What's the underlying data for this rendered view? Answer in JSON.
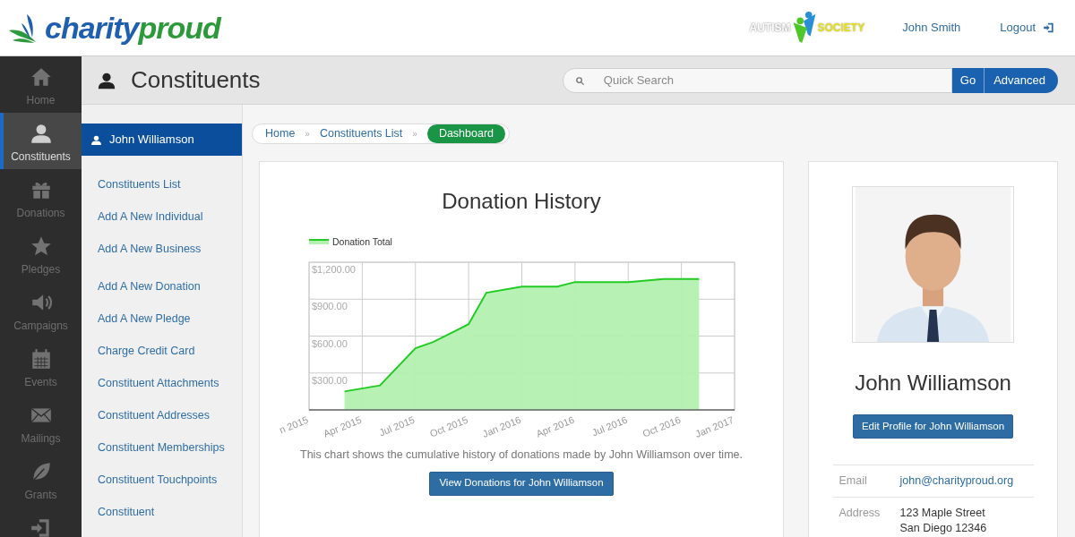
{
  "header": {
    "logo": {
      "first": "charity",
      "second": "proud"
    },
    "org_logo": {
      "first": "AUTISM",
      "second": "SOCIETY"
    },
    "user": "John Smith",
    "logout": "Logout"
  },
  "nav": [
    {
      "label": "Home",
      "kind": "home",
      "selected": false
    },
    {
      "label": "Constituents",
      "kind": "user",
      "selected": true
    },
    {
      "label": "Donations",
      "kind": "gift",
      "selected": false
    },
    {
      "label": "Pledges",
      "kind": "star",
      "selected": false
    },
    {
      "label": "Campaigns",
      "kind": "speaker",
      "selected": false
    },
    {
      "label": "Events",
      "kind": "calendar",
      "selected": false
    },
    {
      "label": "Mailings",
      "kind": "mail",
      "selected": false
    },
    {
      "label": "Grants",
      "kind": "leaf",
      "selected": false
    },
    {
      "kind": "signin",
      "selected": false
    }
  ],
  "page_title": "Constituents",
  "search": {
    "placeholder": "Quick Search",
    "go": "Go",
    "advanced": "Advanced"
  },
  "submenu": {
    "title": "John Williamson",
    "groups": [
      [
        "Constituents List",
        "Add A New Individual",
        "Add A New Business"
      ],
      [
        "Add A New Donation",
        "Add A New Pledge",
        "Charge Credit Card",
        "Constituent Attachments",
        "Constituent Addresses",
        "Constituent Memberships",
        "Constituent Touchpoints",
        "Constituent"
      ]
    ]
  },
  "breadcrumb": [
    {
      "label": "Home",
      "selected": false
    },
    {
      "separator": "»",
      "label": "Constituents List",
      "selected": false
    },
    {
      "separator": "»",
      "label": "Dashboard",
      "selected": true
    }
  ],
  "donation_card": {
    "title": "Donation History",
    "chart_data": {
      "type": "area",
      "categories": [
        "n 2015",
        null,
        null,
        "Apr 2015",
        null,
        null,
        "Jul 2015",
        null,
        null,
        "Oct 2015",
        null,
        null,
        "Jan 2016",
        null,
        null,
        "Apr 2016",
        null,
        null,
        "Jul 2016",
        null,
        null,
        "Oct 2016",
        null,
        null,
        "Jan 2017"
      ],
      "series": [
        {
          "name": "Donation Total",
          "color": "#22cc22",
          "values": [
            null,
            null,
            150,
            null,
            199,
            null,
            501,
            552,
            null,
            697,
            952,
            null,
            1002,
            null,
            1002,
            1039,
            null,
            1039,
            1039,
            null,
            1063,
            null,
            1063,
            null,
            null
          ]
        }
      ],
      "ylim": [
        0,
        1200
      ],
      "grid": true,
      "yticks": [
        {
          "value": 300,
          "label": "$300.00"
        },
        {
          "value": 600,
          "label": "$600.00"
        },
        {
          "value": 900,
          "label": "$900.00"
        },
        {
          "value": 1200,
          "label": "$1,200.00"
        }
      ]
    },
    "caption": "This chart shows the cumulative history of donations made by John Williamson over time.",
    "button": "View Donations for John Williamson"
  },
  "profile": {
    "name": "John Williamson",
    "button": "Edit Profile for John Williamson",
    "fields": [
      {
        "label": "Email",
        "value": "john@charityproud.org",
        "kind": "link"
      },
      {
        "label": "Address",
        "value": "123 Maple Street\nSan Diego 12346",
        "kind": "text"
      }
    ]
  }
}
